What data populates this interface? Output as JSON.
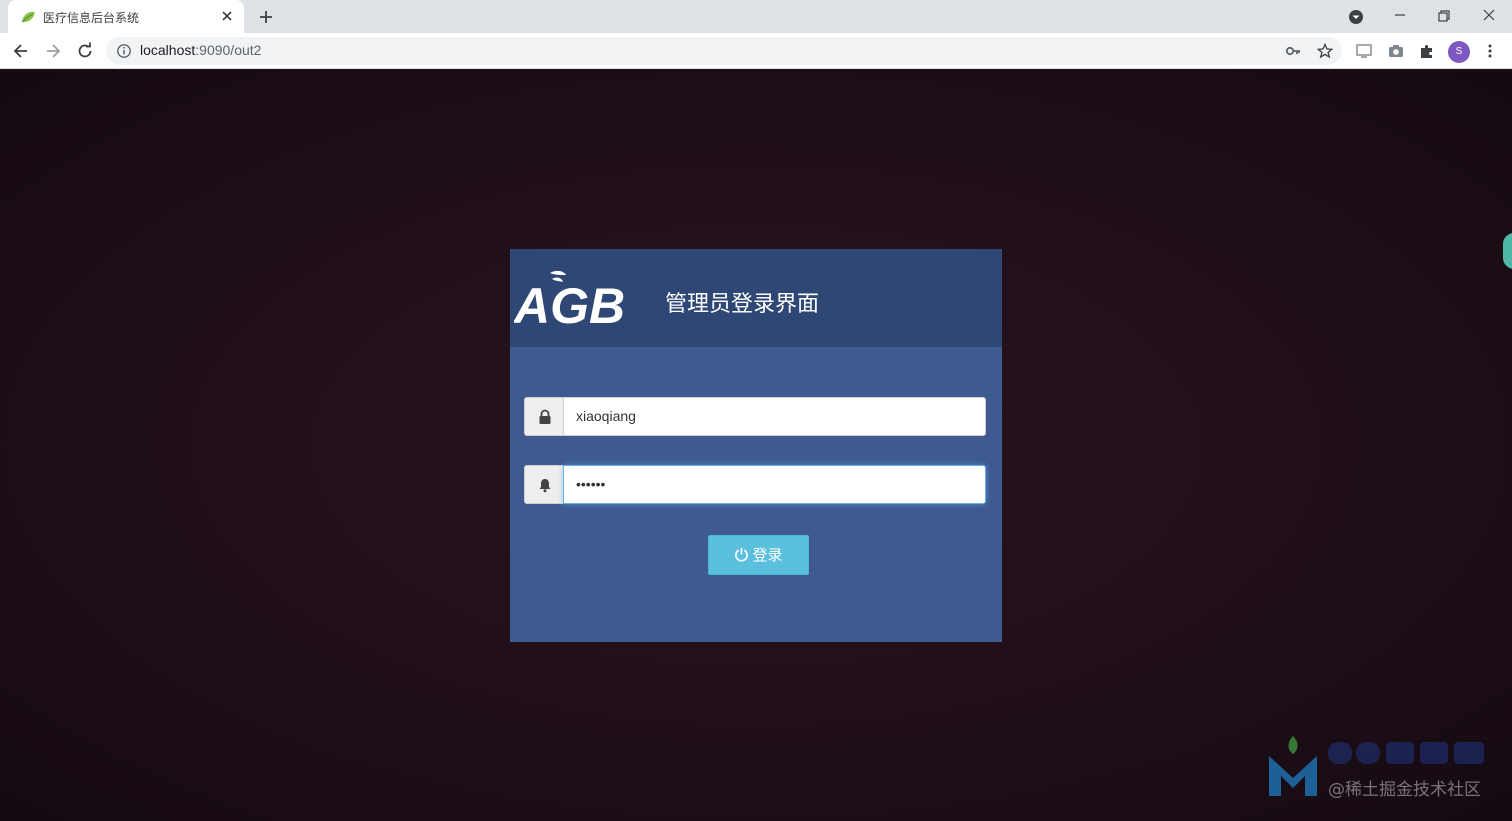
{
  "browser": {
    "tab_title": "医疗信息后台系统",
    "url_host": "localhost",
    "url_rest": ":9090/out2",
    "profile_initial": "S"
  },
  "login": {
    "title": "管理员登录界面",
    "logo_text": "AGB",
    "username_value": "xiaoqiang",
    "password_masked": "••••••",
    "login_button_label": "登录"
  },
  "watermark": {
    "text": "@稀土掘金技术社区"
  },
  "colors": {
    "page_background": "#1f0e18",
    "box_background": "#3e5a90",
    "header_background": "#2f4774",
    "button": "#5bc0de"
  },
  "icons": {
    "username_addon": "lock-icon",
    "password_addon": "bell-icon",
    "button": "power-icon"
  }
}
